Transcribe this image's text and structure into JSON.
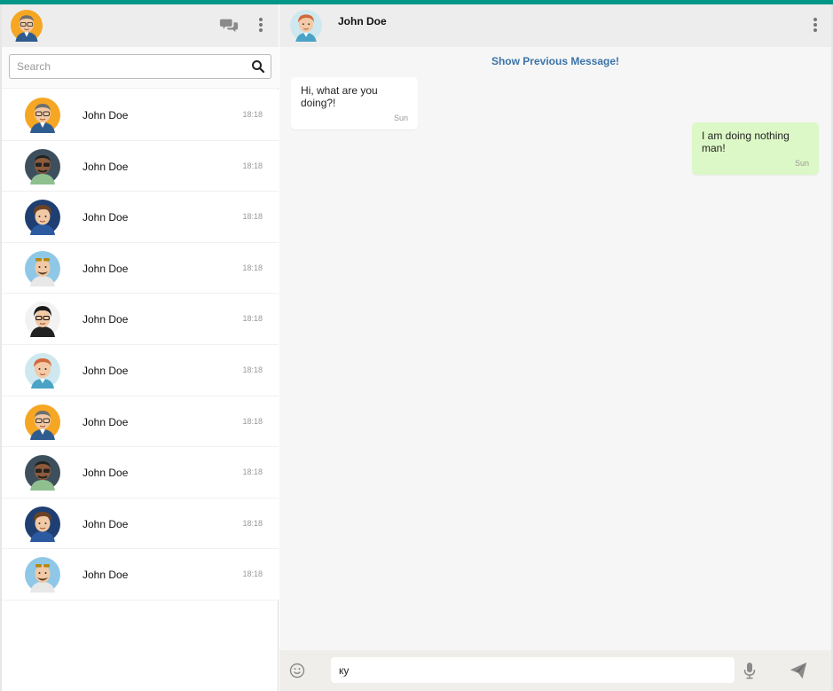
{
  "colors": {
    "accent": "#009688",
    "link": "#3a73a8",
    "outgoing_bubble": "#dcf8c6"
  },
  "sidebar": {
    "header_icons": [
      "avatar",
      "chat-bubbles-icon",
      "more-vertical-icon"
    ],
    "search": {
      "placeholder": "Search",
      "value": ""
    },
    "contacts": [
      {
        "name": "John Doe",
        "time": "18:18",
        "avatar": "man-glasses-orange"
      },
      {
        "name": "John Doe",
        "time": "18:18",
        "avatar": "man-dark-sunglasses"
      },
      {
        "name": "John Doe",
        "time": "18:18",
        "avatar": "man-brown-hair-blue"
      },
      {
        "name": "John Doe",
        "time": "18:18",
        "avatar": "man-sunglasses-head-beard"
      },
      {
        "name": "John Doe",
        "time": "18:18",
        "avatar": "man-black-hair-glasses"
      },
      {
        "name": "John Doe",
        "time": "18:18",
        "avatar": "man-ginger-hair"
      },
      {
        "name": "John Doe",
        "time": "18:18",
        "avatar": "man-glasses-orange"
      },
      {
        "name": "John Doe",
        "time": "18:18",
        "avatar": "man-dark-sunglasses"
      },
      {
        "name": "John Doe",
        "time": "18:18",
        "avatar": "man-brown-hair-blue"
      },
      {
        "name": "John Doe",
        "time": "18:18",
        "avatar": "man-sunglasses-head-beard"
      }
    ]
  },
  "conversation": {
    "contact_name": "John Doe",
    "show_previous": "Show Previous Message!",
    "messages": [
      {
        "direction": "in",
        "text": "Hi, what are you doing?!",
        "time": "Sun"
      },
      {
        "direction": "out",
        "text": "I am doing nothing man!",
        "time": "Sun"
      }
    ],
    "compose": {
      "value": "ку"
    }
  }
}
